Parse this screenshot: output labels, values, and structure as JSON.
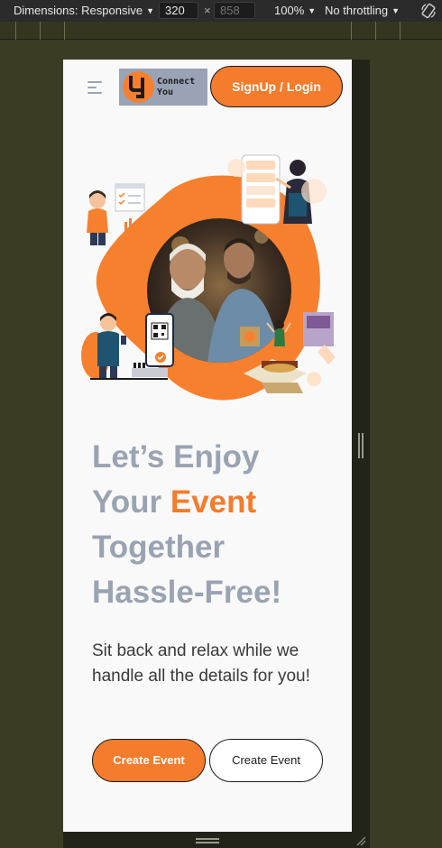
{
  "devtools": {
    "dimensions_label": "Dimensions: Responsive",
    "width_value": "320",
    "height_placeholder": "858",
    "times": "×",
    "zoom_label": "100%",
    "throttling_label": "No throttling",
    "caret": "▼"
  },
  "header": {
    "logo_text": "Connect\nYou",
    "signup_label": "SignUp / Login"
  },
  "hero": {
    "headline_part1": "Let’s Enjoy Your ",
    "headline_accent": "Event",
    "headline_part2": " Together Hassle-Free!",
    "subtext": "Sit back and relax while we handle all the details for you!"
  },
  "actions": {
    "primary_label": "Create Event",
    "secondary_label": "Create Event"
  },
  "colors": {
    "accent": "#f47c2c",
    "muted_heading": "#9aa3b2",
    "page_bg": "#f9f9fa"
  }
}
